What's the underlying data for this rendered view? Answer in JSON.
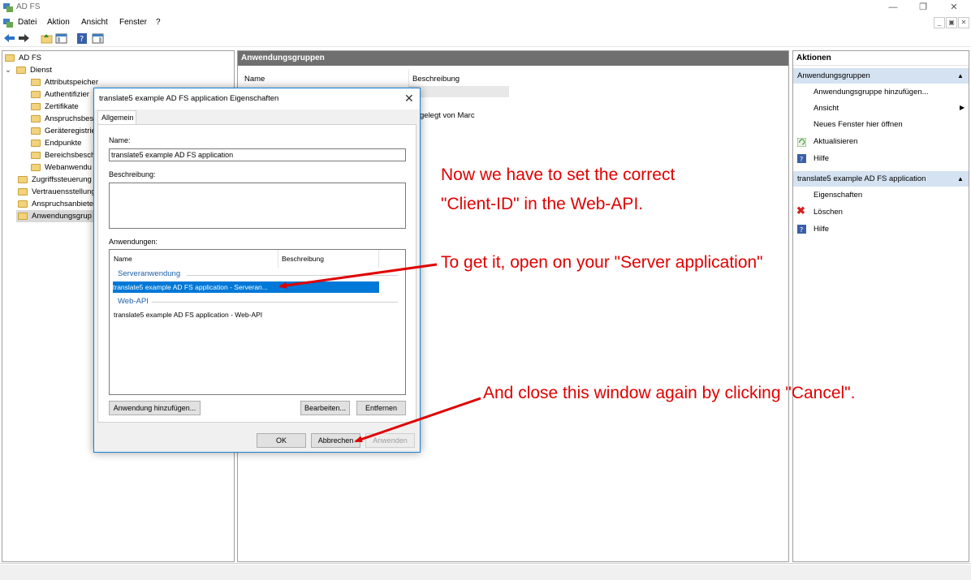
{
  "window": {
    "title": "AD FS"
  },
  "menu": [
    "Datei",
    "Aktion",
    "Ansicht",
    "Fenster",
    "?"
  ],
  "tree": {
    "root": "AD FS",
    "service": "Dienst",
    "service_children": [
      "Attributspeicher",
      "Authentifizier",
      "Zertifikate",
      "Anspruchsbesc",
      "Geräteregistrie",
      "Endpunkte",
      "Bereichsbesch",
      "Webanwendu"
    ],
    "others": [
      "Zugriffssteuerung",
      "Vertrauensstellung",
      "Anspruchsanbiete",
      "Anwendungsgrup"
    ]
  },
  "center": {
    "header": "Anwendungsgruppen",
    "columns": [
      "Name",
      "Beschreibung"
    ],
    "row_description_fragment": "gelegt von Marc"
  },
  "actions": {
    "header": "Aktionen",
    "section1": "Anwendungsgruppen",
    "section1_items": [
      "Anwendungsgruppe hinzufügen...",
      "Ansicht",
      "Neues Fenster hier öffnen",
      "Aktualisieren",
      "Hilfe"
    ],
    "section2": "translate5 example AD FS application",
    "section2_items": [
      "Eigenschaften",
      "Löschen",
      "Hilfe"
    ]
  },
  "dialog": {
    "title": "translate5 example AD FS application Eigenschaften",
    "tab": "Allgemein",
    "name_label": "Name:",
    "name_value": "translate5 example AD FS application",
    "description_label": "Beschreibung:",
    "apps_label": "Anwendungen:",
    "apps_columns": [
      "Name",
      "Beschreibung"
    ],
    "group1": "Serveranwendung",
    "group1_item": "translate5 example AD FS application - Serveran...",
    "group2": "Web-API",
    "group2_item": "translate5 example AD FS application - Web-API",
    "btn_add": "Anwendung hinzufügen...",
    "btn_edit": "Bearbeiten...",
    "btn_remove": "Entfernen",
    "btn_ok": "OK",
    "btn_cancel": "Abbrechen",
    "btn_apply": "Anwenden"
  },
  "annotations": {
    "note1_line1": "Now we have to set the correct",
    "note1_line2": "\"Client-ID\" in the Web-API.",
    "note2": "To get it, open on your \"Server application\"",
    "note3": "And close this window again by clicking \"Cancel\".",
    "color": "#e00000"
  },
  "colors": {
    "selection": "#0078d7",
    "actions_section": "#d5e2f1",
    "center_header": "#6f6f6f",
    "dialog_border": "#1883d7"
  }
}
